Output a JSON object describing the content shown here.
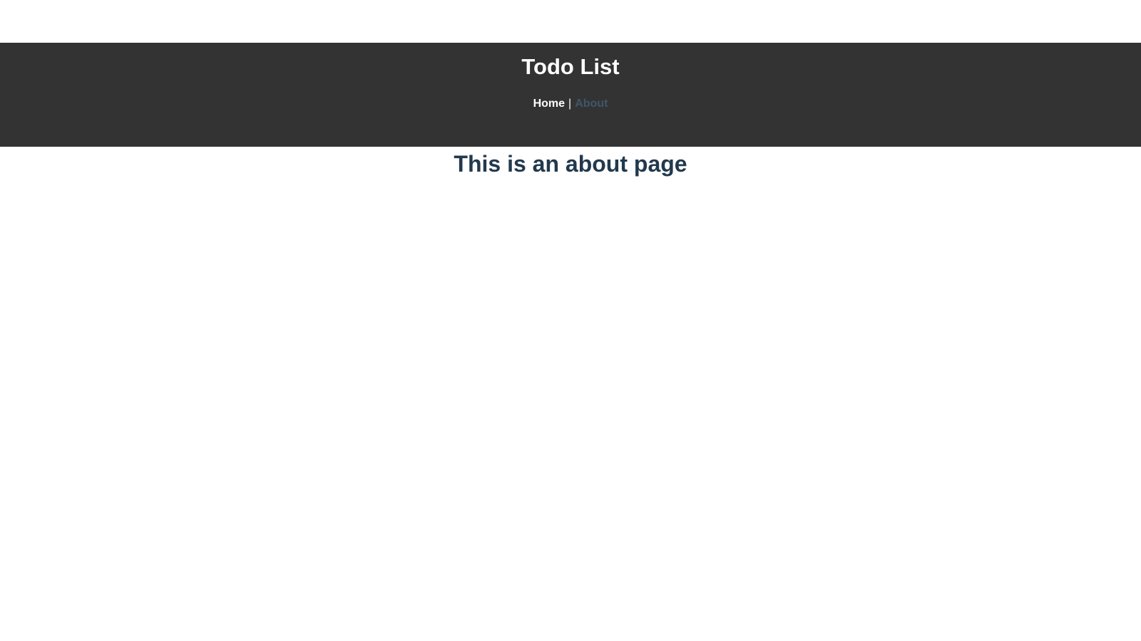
{
  "header": {
    "title": "Todo List",
    "nav": {
      "home_label": "Home",
      "separator": "|",
      "about_label": "About"
    }
  },
  "main": {
    "heading": "This is an about page"
  },
  "colors": {
    "header_bg": "#333333",
    "header_text": "#ffffff",
    "active_link": "#3e5768",
    "heading_text": "#22394d"
  }
}
